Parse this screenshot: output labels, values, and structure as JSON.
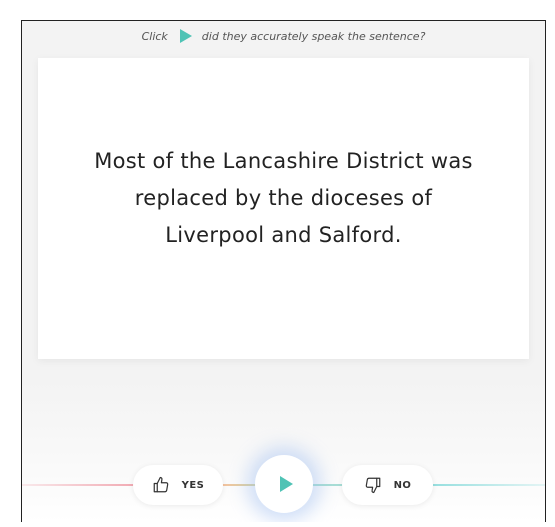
{
  "instruction": {
    "prefix": "Click",
    "suffix": "did they accurately speak the sentence?",
    "icon": "play-icon"
  },
  "sentence": "Most of the Lancashire District was replaced by the dioceses of Liverpool and Salford.",
  "controls": {
    "yes_label": "YES",
    "no_label": "NO",
    "yes_icon": "thumbs-up-icon",
    "no_icon": "thumbs-down-icon",
    "play_icon": "play-icon"
  },
  "colors": {
    "accent": "#4fc3b5",
    "glow": "#96b9f0"
  }
}
